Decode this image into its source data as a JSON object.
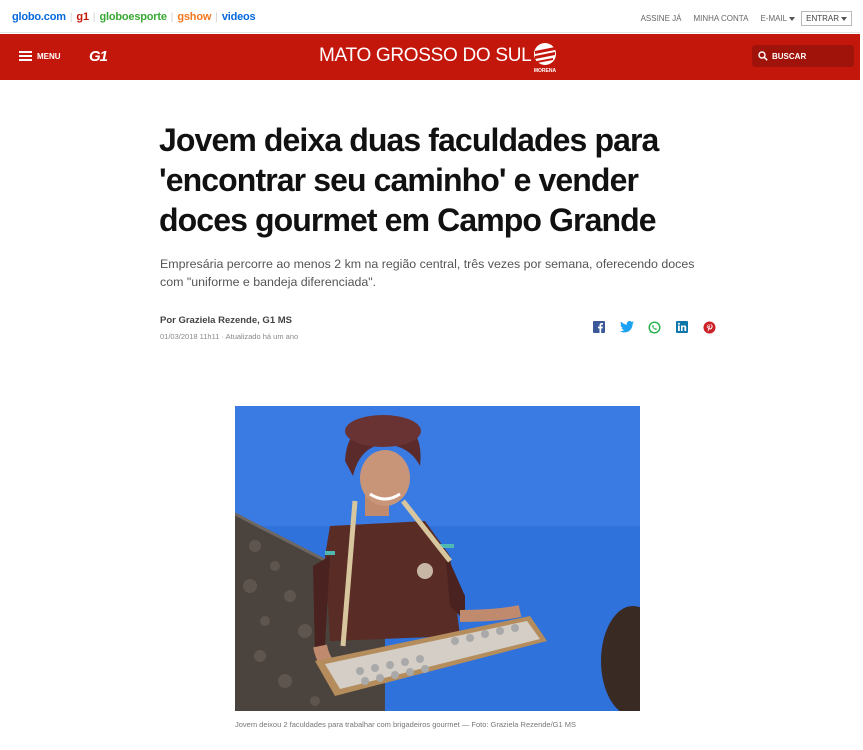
{
  "globobar": {
    "links": [
      {
        "label": "globo.com",
        "color": "#0669de"
      },
      {
        "label": "g1",
        "color": "#c4170c"
      },
      {
        "label": "globoesporte",
        "color": "#39a935"
      },
      {
        "label": "gshow",
        "color": "#f47721"
      },
      {
        "label": "videos",
        "color": "#0669de"
      }
    ],
    "right": {
      "subscribe": "ASSINE JÁ",
      "account": "MINHA CONTA",
      "email": "E-MAIL",
      "login": "ENTRAR"
    }
  },
  "header": {
    "menu_label": "MENU",
    "logo": "G1",
    "section": "MATO GROSSO DO SUL",
    "affiliate": "MORENA",
    "search_label": "BUSCAR",
    "bg_color": "#c4170c"
  },
  "article": {
    "title": "Jovem deixa duas faculdades para 'encontrar seu caminho' e vender doces gourmet em Campo Grande",
    "subtitle": "Empresária percorre ao menos 2 km na região central, três vezes por semana, oferecendo doces com \"uniforme e bandeja diferenciada\".",
    "author": "Por Graziela Rezende, G1 MS",
    "date": "01/03/2018 11h11 · Atualizado há um ano",
    "share_icons": [
      "facebook-icon",
      "twitter-icon",
      "whatsapp-icon",
      "linkedin-icon",
      "pinterest-icon"
    ],
    "photo_caption": "Jovem deixou 2 faculdades para trabalhar com brigadeiros gourmet — Foto: Graziela Rezende/G1 MS"
  }
}
